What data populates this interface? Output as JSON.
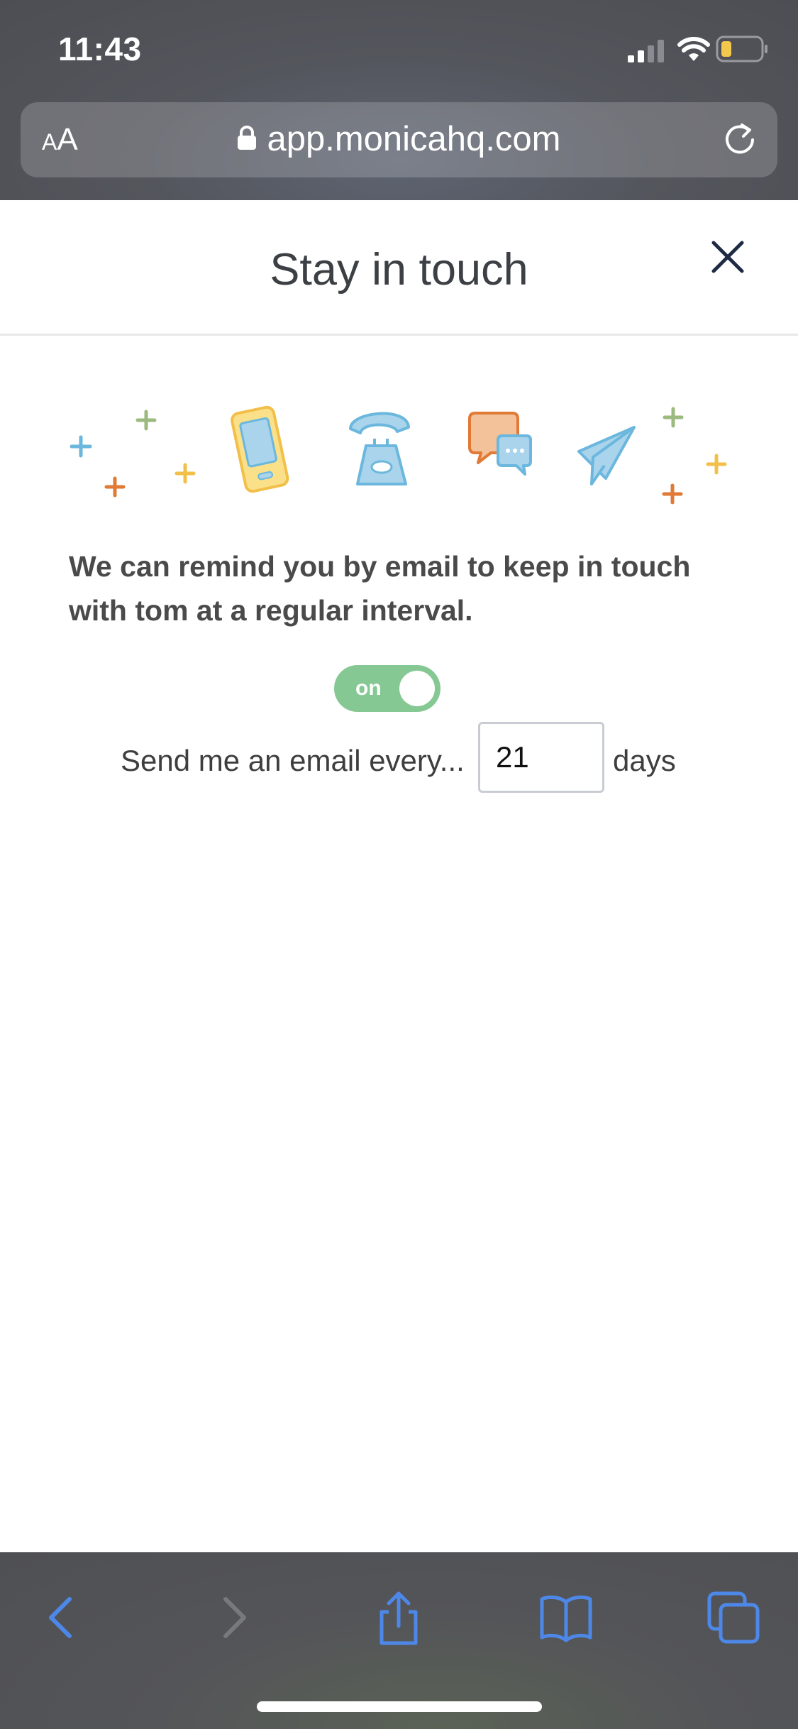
{
  "status_bar": {
    "time": "11:43",
    "icons": [
      "cellular-signal-icon",
      "wifi-icon",
      "battery-low-icon"
    ],
    "battery_color": "#f2c94c"
  },
  "browser": {
    "text_size_button": {
      "small": "A",
      "large": "A"
    },
    "url": "app.monicahq.com",
    "icons": [
      "lock-icon",
      "reload-icon"
    ]
  },
  "modal": {
    "title": "Stay in touch",
    "close_icon": "close-icon",
    "illustration_icons": [
      "smartphone-icon",
      "telephone-icon",
      "chat-bubbles-icon",
      "paper-plane-icon",
      "plus-icon"
    ],
    "reminder_text": "We can remind you by email to keep in touch with tom at a regular interval.",
    "toggle": {
      "label": "on",
      "state": true,
      "color": "#86c894"
    },
    "interval": {
      "label": "Send me an email every...",
      "value": "21",
      "unit": "days"
    }
  },
  "toolbar": {
    "buttons": [
      "back-icon",
      "forward-icon",
      "share-icon",
      "bookmarks-icon",
      "tabs-icon"
    ],
    "accent_color": "#4d88e8"
  }
}
